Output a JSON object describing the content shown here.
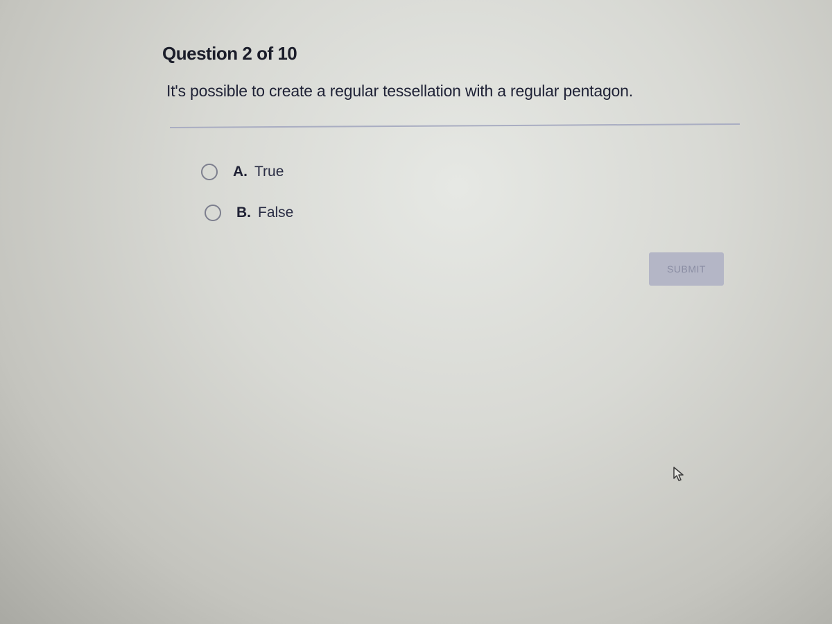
{
  "quiz": {
    "header": "Question 2 of 10",
    "question": "It's possible to create a regular tessellation with a regular pentagon.",
    "options": [
      {
        "letter": "A.",
        "label": "True",
        "selected": false
      },
      {
        "letter": "B.",
        "label": "False",
        "selected": false
      }
    ],
    "submit_label": "SUBMIT",
    "submit_enabled": false
  },
  "icons": {
    "cursor": "mouse-pointer-icon"
  }
}
